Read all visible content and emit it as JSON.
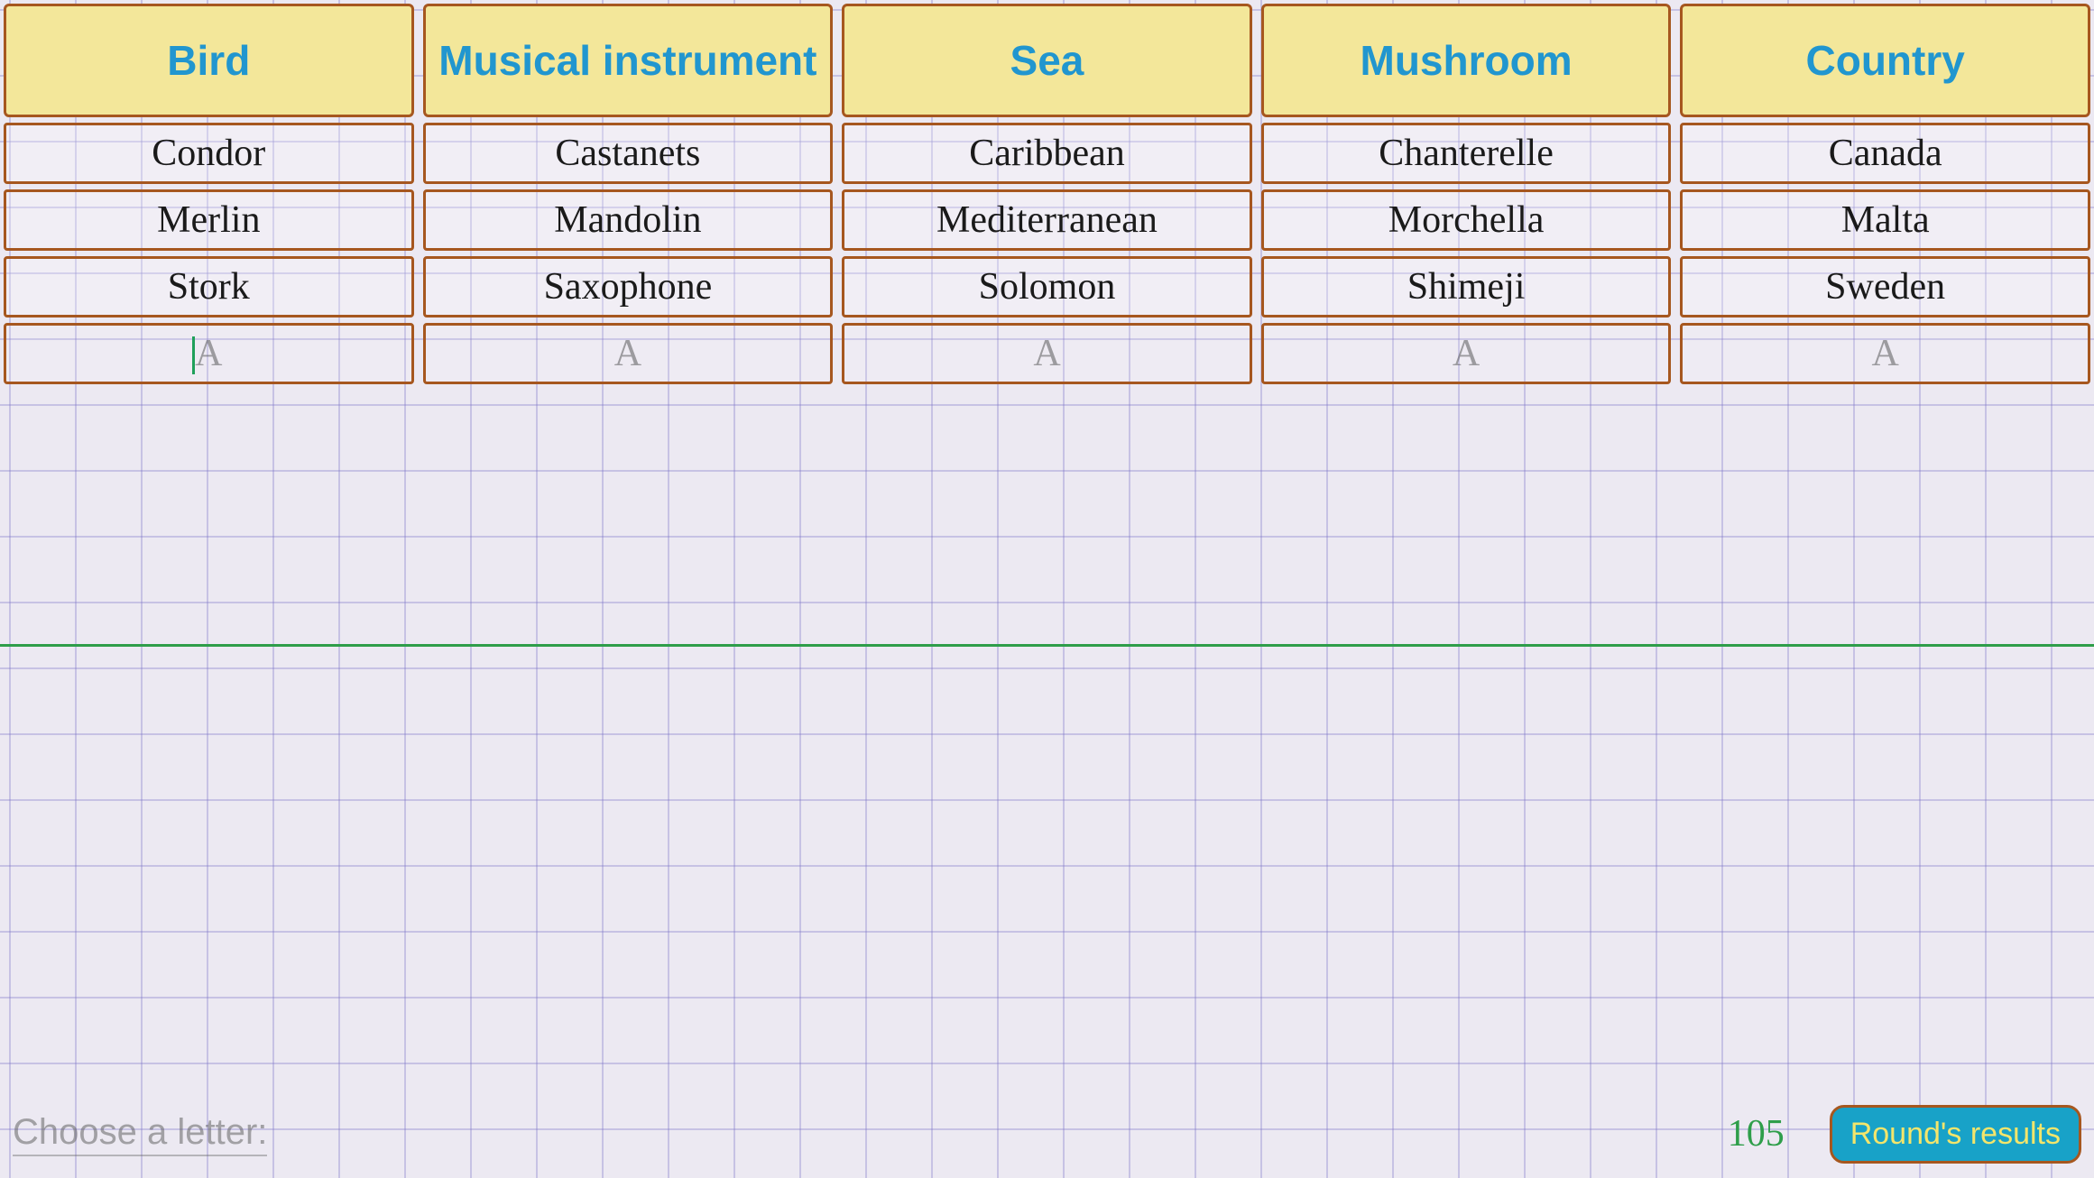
{
  "categories": [
    "Bird",
    "Musical instrument",
    "Sea",
    "Mushroom",
    "Country"
  ],
  "rows": [
    [
      "Condor",
      "Castanets",
      "Caribbean",
      "Chanterelle",
      "Canada"
    ],
    [
      "Merlin",
      "Mandolin",
      "Mediterranean",
      "Morchella",
      "Malta"
    ],
    [
      "Stork",
      "Saxophone",
      "Solomon",
      "Shimeji",
      "Sweden"
    ]
  ],
  "input_placeholder": "A",
  "bottom": {
    "choose_label": "Choose a letter:",
    "score": "105",
    "results_label": "Round's results"
  }
}
